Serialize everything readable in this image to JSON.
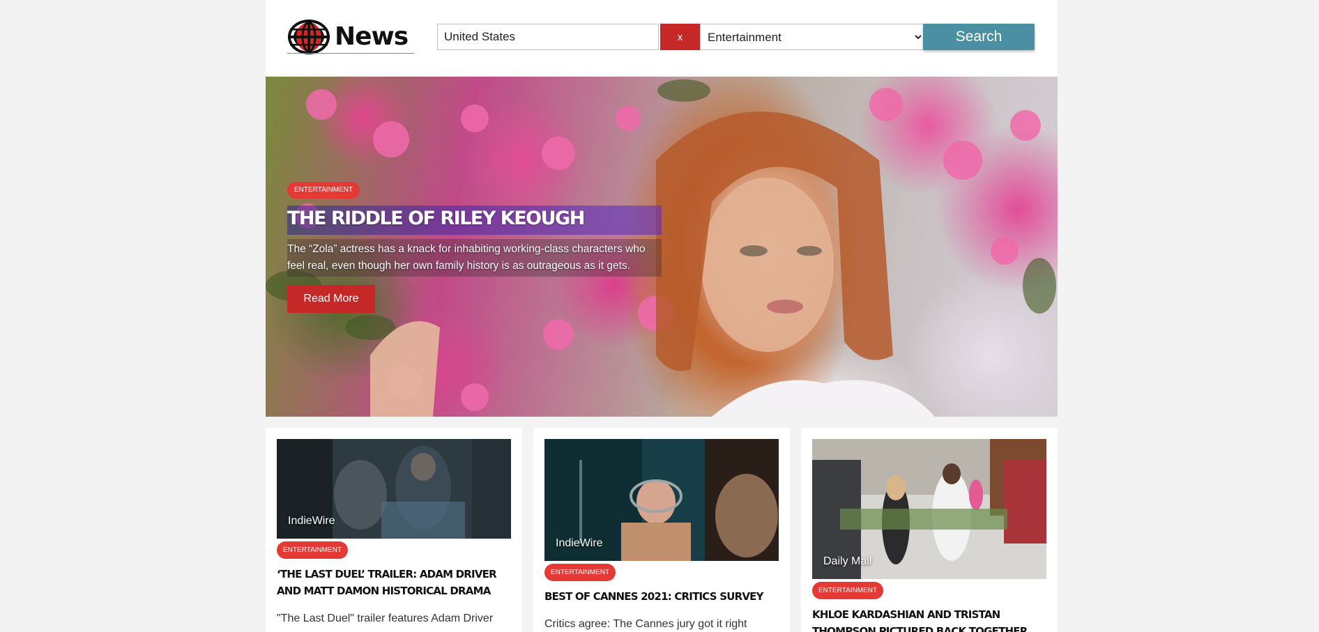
{
  "header": {
    "logo_text": "News",
    "search_value": "United States",
    "clear_label": "x",
    "category_selected": "Entertainment",
    "category_options": [
      "Entertainment"
    ],
    "search_label": "Search"
  },
  "hero": {
    "badge": "ENTERTAINMENT",
    "title": "THE RIDDLE OF RILEY KEOUGH",
    "description": "The “Zola” actress has a knack for inhabiting working-class characters who feel real, even though her own family history is as outrageous as it gets.",
    "button_label": "Read More"
  },
  "cards": [
    {
      "source": "IndieWire",
      "badge": "ENTERTAINMENT",
      "title": "‘The Last Duel’ Trailer: Adam Driver and Matt Damon Historical Drama",
      "description": "\"The Last Duel\" trailer features Adam Driver"
    },
    {
      "source": "IndieWire",
      "badge": "ENTERTAINMENT",
      "title": "Best of Cannes 2021: Critics Survey",
      "description": "Critics agree: The Cannes jury got it right again."
    },
    {
      "source": "Daily Mail",
      "badge": "ENTERTAINMENT",
      "title": "Khloe Kardashian and Tristan Thompson pictured back together",
      "description": ""
    }
  ],
  "colors": {
    "accent_red": "#c62828",
    "badge_red": "#e53935",
    "search_blue": "#4b8fa3",
    "background": "#f3f3f3"
  }
}
